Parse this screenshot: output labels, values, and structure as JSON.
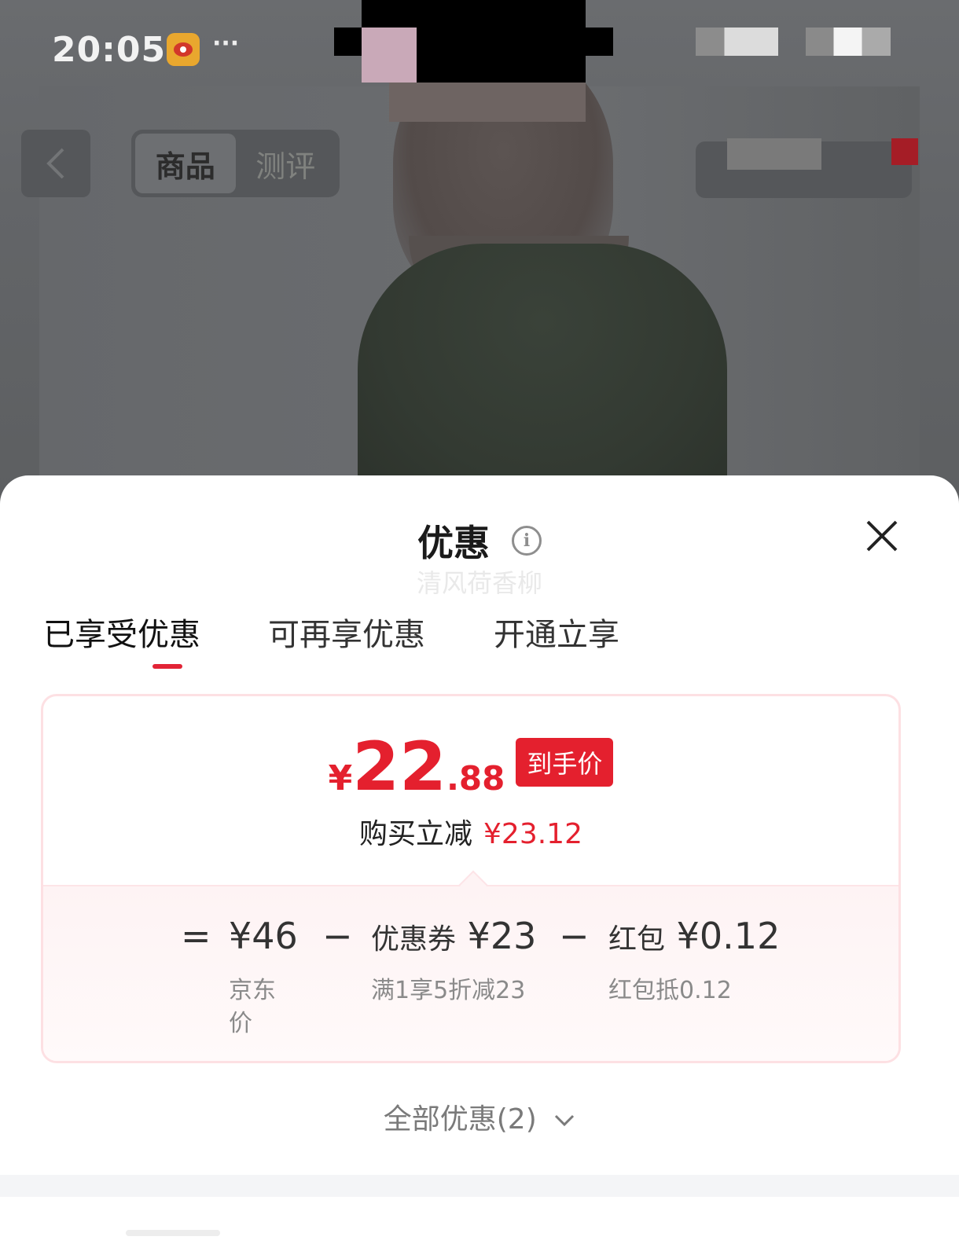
{
  "status_bar": {
    "time": "20:05",
    "app_icon": "weibo-icon",
    "more": "···"
  },
  "nav": {
    "back_icon": "chevron-left-icon",
    "tabs": [
      {
        "label": "商品",
        "active": true
      },
      {
        "label": "测评",
        "active": false
      }
    ]
  },
  "sheet": {
    "title": "优惠",
    "info_icon": "i",
    "watermark": "清风荷香柳",
    "close_icon": "close-icon",
    "tabs": [
      {
        "label": "已享受优惠",
        "active": true
      },
      {
        "label": "可再享优惠",
        "active": false
      },
      {
        "label": "开通立享",
        "active": false
      }
    ],
    "price": {
      "currency": "¥",
      "integer": "22",
      "decimal": ".88",
      "badge": "到手价"
    },
    "instant": {
      "label": "购买立减",
      "amount": "¥23.12"
    },
    "breakdown": {
      "equals": "=",
      "minus": "−",
      "items": [
        {
          "label": "",
          "value": "¥46",
          "sub_line1": "京东",
          "sub_line2": "价"
        },
        {
          "label": "优惠券",
          "value": "¥23",
          "sub_line1": "满1享5折减23",
          "sub_line2": ""
        },
        {
          "label": "红包",
          "value": "¥0.12",
          "sub_line1": "红包抵0.12",
          "sub_line2": ""
        }
      ]
    },
    "all_offers": "全部优惠(2)"
  },
  "colors": {
    "accent": "#e4202e",
    "card_border": "#fde0e3",
    "overlay": "#5f6163"
  }
}
